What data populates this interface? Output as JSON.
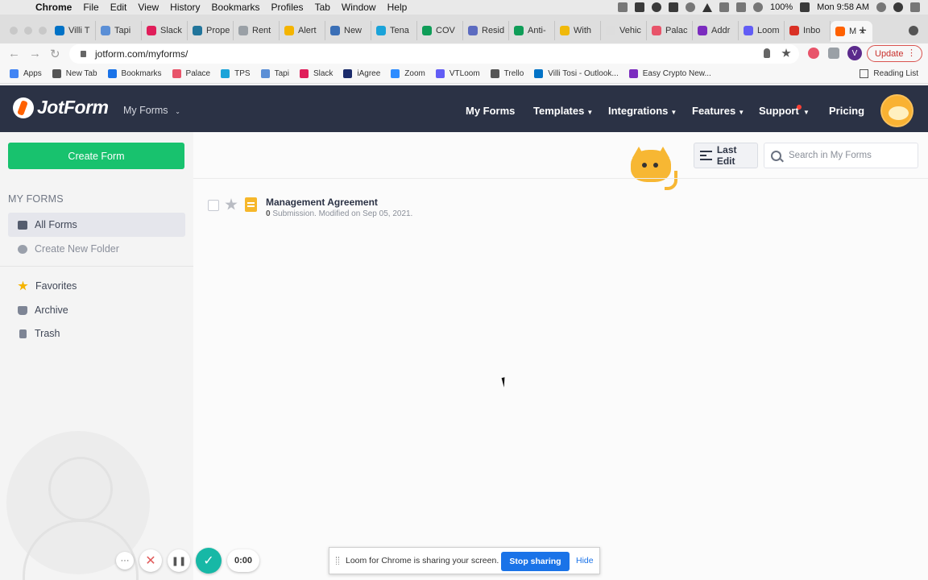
{
  "menubar": {
    "app": "Chrome",
    "items": [
      "File",
      "Edit",
      "View",
      "History",
      "Bookmarks",
      "Profiles",
      "Tab",
      "Window",
      "Help"
    ],
    "battery": "100%",
    "clock": "Mon 9:58 AM"
  },
  "tabs": [
    {
      "label": "Villi T",
      "color": "#0072c6"
    },
    {
      "label": "Tapi",
      "color": "#5b8fd6"
    },
    {
      "label": "Slack",
      "color": "#e01e5a"
    },
    {
      "label": "Prope",
      "color": "#21759b"
    },
    {
      "label": "Rent",
      "color": "#9aa0a6"
    },
    {
      "label": "Alert",
      "color": "#f4b400"
    },
    {
      "label": "New",
      "color": "#3b6fb6"
    },
    {
      "label": "Tena",
      "color": "#1aa3d9"
    },
    {
      "label": "COV",
      "color": "#0f9d58"
    },
    {
      "label": "Resid",
      "color": "#5c6bc0"
    },
    {
      "label": "Anti-",
      "color": "#0f9d58"
    },
    {
      "label": "With",
      "color": "#f0b90b"
    },
    {
      "label": "Vehic",
      "color": "#dddddd"
    },
    {
      "label": "Palac",
      "color": "#e8546a"
    },
    {
      "label": "Addr",
      "color": "#7b2cbf"
    },
    {
      "label": "Loom",
      "color": "#625df5"
    },
    {
      "label": "Inbo",
      "color": "#d93025"
    }
  ],
  "active_tab": {
    "label": "M",
    "close": "×"
  },
  "address": {
    "url": "jotform.com/myforms/",
    "update_label": "Update",
    "profile_initial": "V"
  },
  "bookmarks": [
    {
      "label": "Apps",
      "color": "#4285f4"
    },
    {
      "label": "New Tab",
      "color": "#555555"
    },
    {
      "label": "Bookmarks",
      "color": "#1a73e8"
    },
    {
      "label": "Palace",
      "color": "#e8546a"
    },
    {
      "label": "TPS",
      "color": "#1aa3d9"
    },
    {
      "label": "Tapi",
      "color": "#5b8fd6"
    },
    {
      "label": "Slack",
      "color": "#e01e5a"
    },
    {
      "label": "iAgree",
      "color": "#1b2b6b"
    },
    {
      "label": "Zoom",
      "color": "#2d8cff"
    },
    {
      "label": "VTLoom",
      "color": "#625df5"
    },
    {
      "label": "Trello",
      "color": "#555555"
    },
    {
      "label": "Villi Tosi - Outlook...",
      "color": "#0072c6"
    },
    {
      "label": "Easy Crypto New...",
      "color": "#7b2cbf"
    }
  ],
  "reading_list": "Reading List",
  "header": {
    "logo_text": "JotForm",
    "workspace_dropdown": "My Forms",
    "nav": [
      "My Forms",
      "Templates",
      "Integrations",
      "Features",
      "Support",
      "Pricing"
    ]
  },
  "sidebar": {
    "create_button": "Create Form",
    "section_title": "MY FORMS",
    "all_forms": "All Forms",
    "create_folder": "Create New Folder",
    "favorites": "Favorites",
    "archive": "Archive",
    "trash": "Trash"
  },
  "toolbar": {
    "sort_label": "Last Edit",
    "search_placeholder": "Search in My Forms"
  },
  "forms": [
    {
      "title": "Management Agreement",
      "submissions": "0",
      "meta": " Submission. Modified on Sep 05, 2021."
    }
  ],
  "loom": {
    "more": "···",
    "cancel": "✕",
    "pause": "❚❚",
    "done": "✓",
    "timer": "0:00",
    "share_message": "Loom for Chrome is sharing your screen.",
    "stop_label": "Stop sharing",
    "hide_label": "Hide"
  }
}
